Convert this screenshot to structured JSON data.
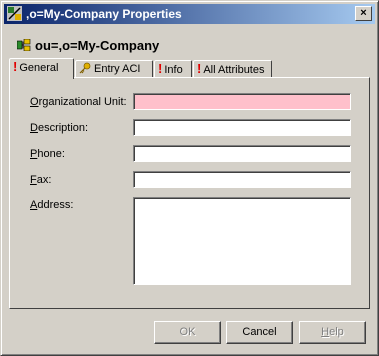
{
  "window": {
    "title": ",o=My-Company Properties",
    "close_glyph": "×"
  },
  "entry": {
    "title": "ou=,o=My-Company",
    "icon": "org-unit-icon"
  },
  "tabs": [
    {
      "label": "General",
      "icon": "exclamation-icon",
      "active": true
    },
    {
      "label": "Entry ACI",
      "icon": "key-icon",
      "active": false
    },
    {
      "label": "Info",
      "icon": "exclamation-icon",
      "active": false
    },
    {
      "label": "All Attributes",
      "icon": "exclamation-icon",
      "active": false
    }
  ],
  "form": {
    "ou": {
      "label_prefix": "",
      "label_accel": "O",
      "label_rest": "rganizational Unit:",
      "value": ""
    },
    "description": {
      "label_prefix": "",
      "label_accel": "D",
      "label_rest": "escription:",
      "value": ""
    },
    "phone": {
      "label_prefix": "",
      "label_accel": "P",
      "label_rest": "hone:",
      "value": ""
    },
    "fax": {
      "label_prefix": "",
      "label_accel": "F",
      "label_rest": "ax:",
      "value": ""
    },
    "address": {
      "label_prefix": "",
      "label_accel": "A",
      "label_rest": "ddress:",
      "value": ""
    }
  },
  "buttons": {
    "ok": "OK",
    "cancel": "Cancel",
    "help_accel": "H",
    "help_rest": "elp"
  },
  "colors": {
    "required_field": "#ffc0cb",
    "title_gradient_start": "#0a246a",
    "title_gradient_end": "#a6caf0"
  }
}
